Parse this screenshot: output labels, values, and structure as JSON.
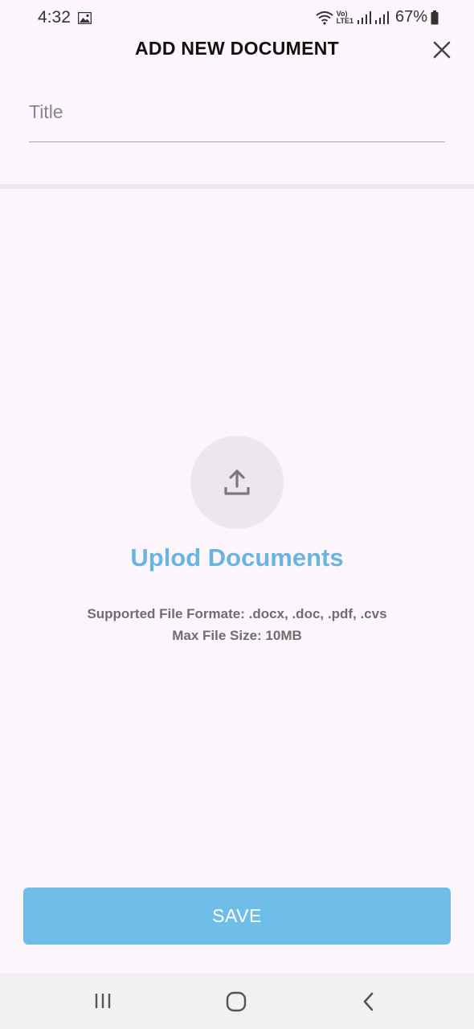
{
  "status_bar": {
    "time": "4:32",
    "network_label_top": "Vo)",
    "network_label_bottom": "LTE1",
    "battery_percent": "67%"
  },
  "header": {
    "title": "ADD NEW DOCUMENT",
    "close_icon": "close-icon"
  },
  "form": {
    "title_placeholder": "Title",
    "title_value": ""
  },
  "upload": {
    "icon": "upload-icon",
    "heading": "Uplod Documents",
    "supported_formats": "Supported File Formate: .docx, .doc, .pdf, .cvs",
    "max_size": "Max File Size: 10MB"
  },
  "actions": {
    "save_label": "SAVE"
  },
  "colors": {
    "accent": "#6fbeea",
    "heading": "#6cb4e0",
    "background": "#fcf6fc"
  }
}
